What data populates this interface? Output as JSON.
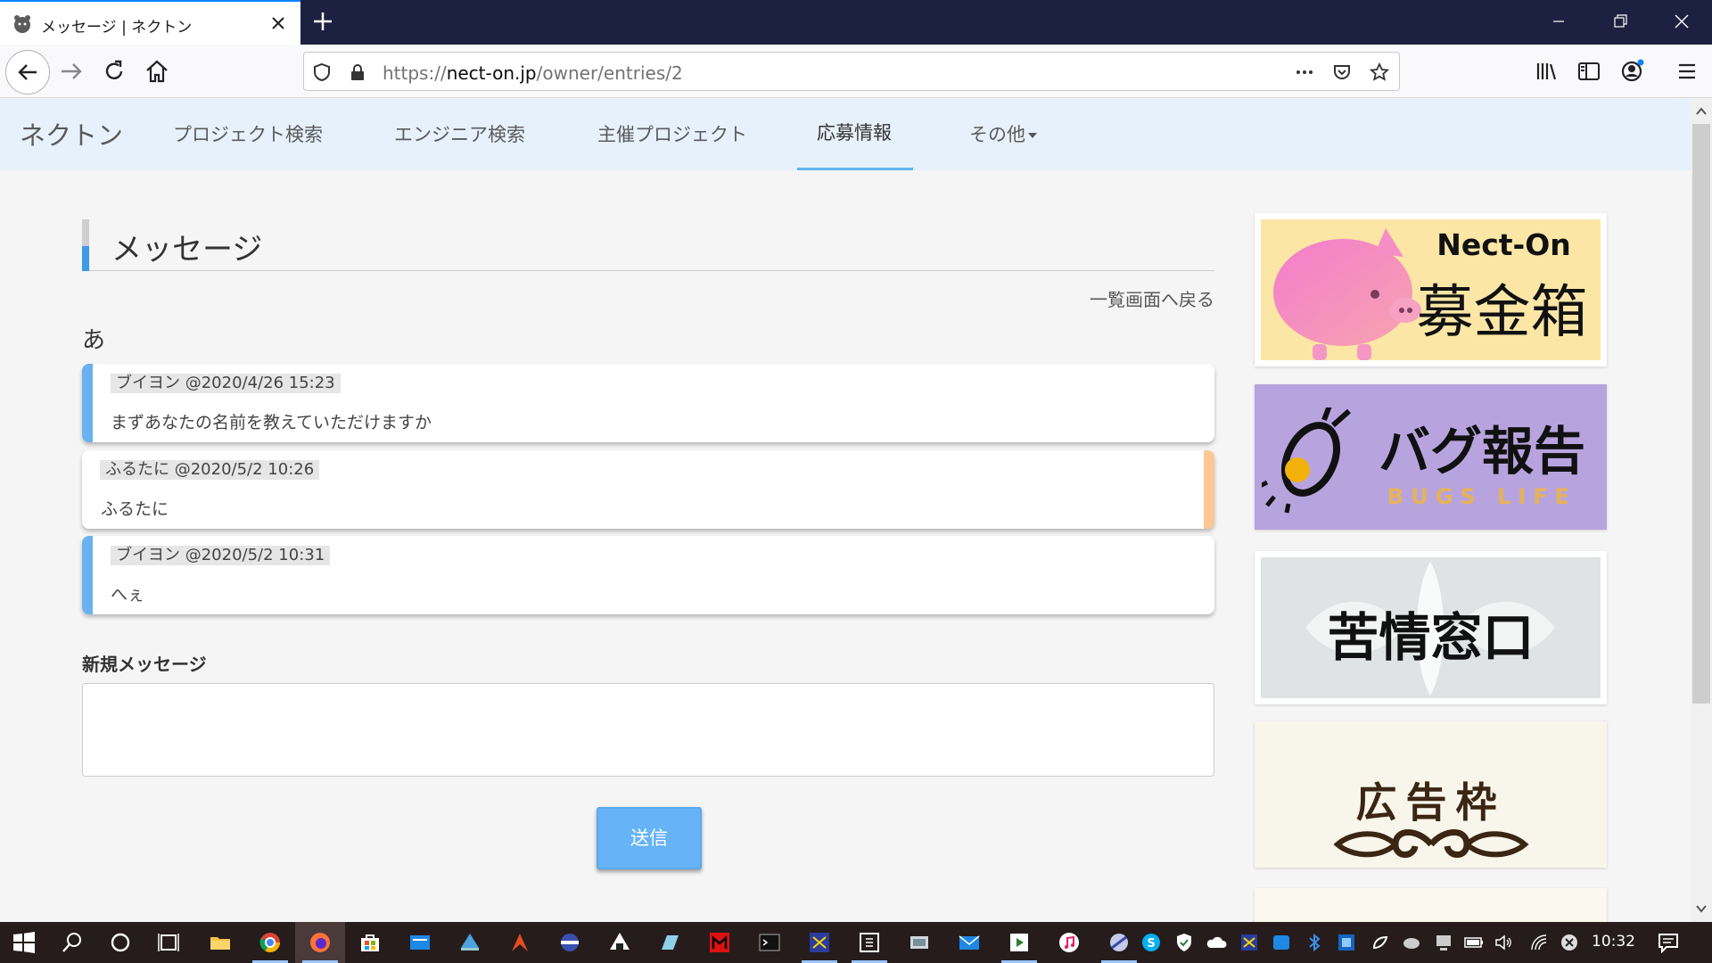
{
  "browser": {
    "tab_title": "メッセージ | ネクトン",
    "url_prefix": "https://",
    "url_host": "nect-on.jp",
    "url_path": "/owner/entries/2"
  },
  "site_nav": {
    "brand": "ネクトン",
    "links": [
      {
        "label": "プロジェクト検索"
      },
      {
        "label": "エンジニア検索"
      },
      {
        "label": "主催プロジェクト"
      },
      {
        "label": "応募情報",
        "active": true
      },
      {
        "label": "その他"
      }
    ]
  },
  "main": {
    "heading": "メッセージ",
    "back_link": "一覧画面へ戻る",
    "subject": "あ",
    "messages": [
      {
        "author_time": "ブイヨン @2020/4/26 15:23",
        "body": "まずあなたの名前を教えていただけますか",
        "side": "left"
      },
      {
        "author_time": "ふるたに @2020/5/2 10:26",
        "body": "ふるたに",
        "side": "right"
      },
      {
        "author_time": "ブイヨン @2020/5/2 10:31",
        "body": "へぇ",
        "side": "left"
      }
    ],
    "new_message_label": "新規メッセージ",
    "new_message_value": "",
    "send_label": "送信"
  },
  "ads": [
    {
      "title": "Nect-On",
      "subtitle": "募金箱"
    },
    {
      "title": "バグ報告",
      "subtitle": "BUGS LIFE"
    },
    {
      "title": "苦情窓口"
    },
    {
      "title": "広告枠"
    }
  ],
  "taskbar": {
    "clock": "10:32"
  },
  "colors": {
    "nav_bg": "#e6f1fb",
    "accent_blue": "#3d9ae8",
    "msg_left": "#69b1ef",
    "msg_right": "#ffc793",
    "send_button": "#66b3f7"
  }
}
